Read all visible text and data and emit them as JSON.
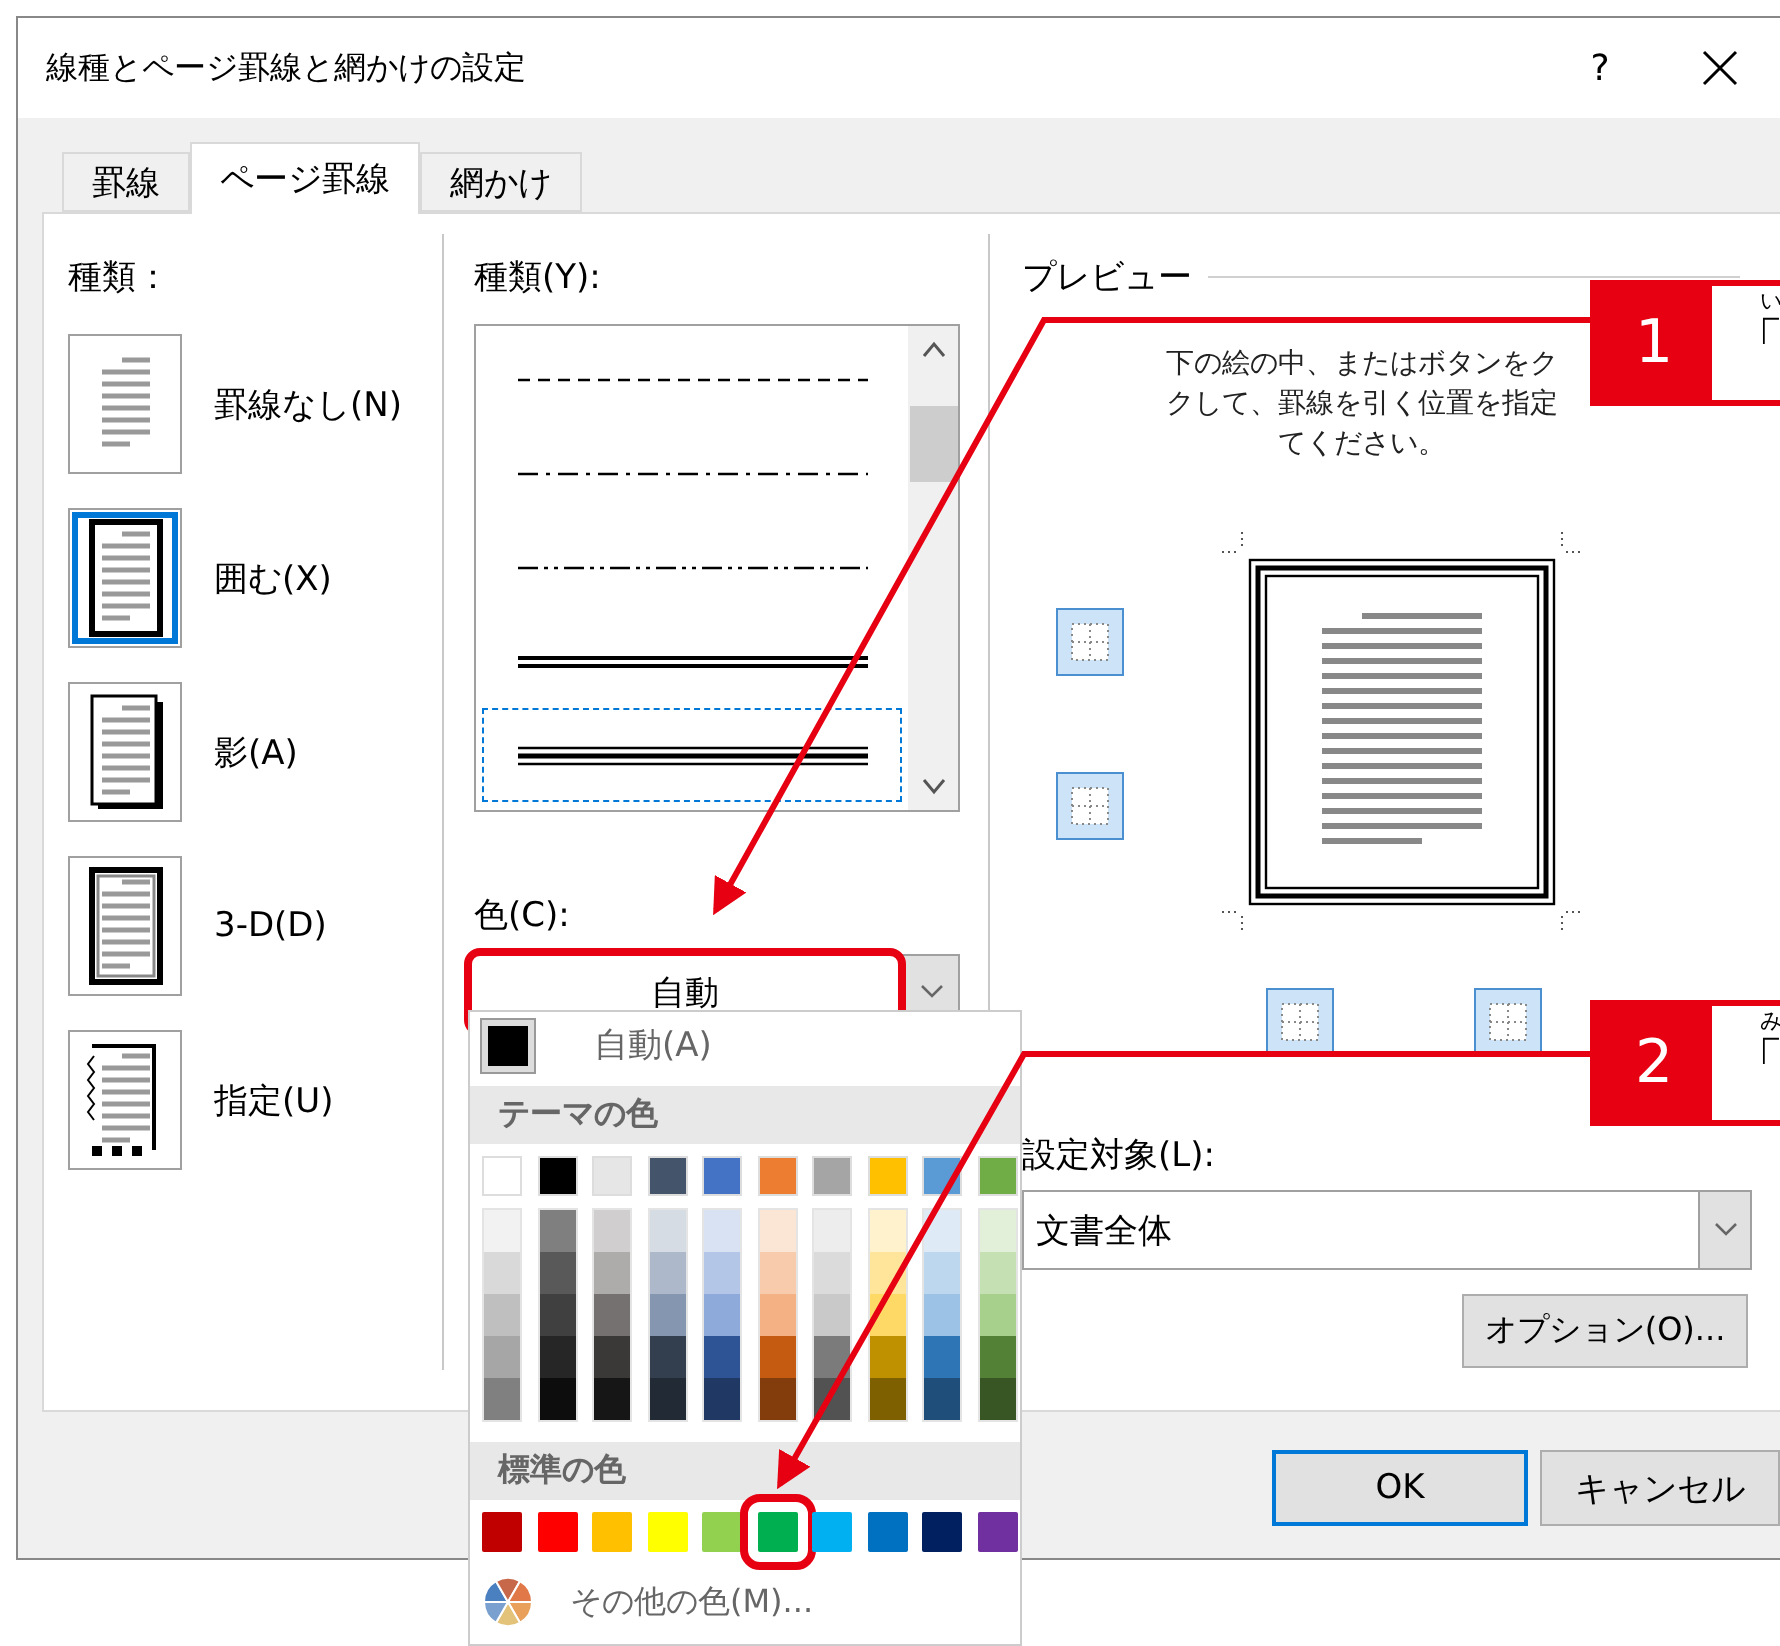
{
  "window": {
    "title": "線種とページ罫線と網かけの設定",
    "help": "?"
  },
  "tabs": [
    {
      "label": "罫線",
      "selected": false
    },
    {
      "label": "ページ罫線",
      "selected": true
    },
    {
      "label": "網かけ",
      "selected": false
    }
  ],
  "setting": {
    "label": "種類：",
    "items": [
      {
        "label": "罫線なし(N)",
        "kind": "none",
        "selected": false
      },
      {
        "label": "囲む(X)",
        "kind": "box",
        "selected": true
      },
      {
        "label": "影(A)",
        "kind": "shadow",
        "selected": false
      },
      {
        "label": "3-D(D)",
        "kind": "threed",
        "selected": false
      },
      {
        "label": "指定(U)",
        "kind": "custom",
        "selected": false
      }
    ]
  },
  "line_style": {
    "label": "種類(Y):",
    "items": [
      {
        "kind": "dashed",
        "selected": false
      },
      {
        "kind": "dashdot",
        "selected": false
      },
      {
        "kind": "dashdotdot",
        "selected": false
      },
      {
        "kind": "double",
        "selected": false
      },
      {
        "kind": "triple",
        "selected": true
      }
    ]
  },
  "color": {
    "label": "色(C):",
    "value": "自動",
    "highlighted": true
  },
  "preview": {
    "title": "プレビュー",
    "instructions": [
      "下の絵の中、またはボタンをク",
      "クして、罫線を引く位置を指定",
      "てください。"
    ]
  },
  "apply_to": {
    "label": "設定対象(L):",
    "value": "文書全体"
  },
  "options_button": "オプション(O)...",
  "buttons": [
    {
      "label": "OK",
      "selected": true
    },
    {
      "label": "キャンセル",
      "selected": false
    }
  ],
  "color_menu": {
    "automatic": "自動(A)",
    "theme_heading": "テーマの色",
    "theme_colors": [
      {
        "color": "#ffffff",
        "children": [
          {
            "color": "#f2f2f2"
          },
          {
            "color": "#d9d9d9"
          },
          {
            "color": "#bfbfbf"
          },
          {
            "color": "#a6a6a6"
          },
          {
            "color": "#808080"
          }
        ]
      },
      {
        "color": "#000000",
        "children": [
          {
            "color": "#7f7f7f"
          },
          {
            "color": "#595959"
          },
          {
            "color": "#404040"
          },
          {
            "color": "#262626"
          },
          {
            "color": "#0d0d0d"
          }
        ]
      },
      {
        "color": "#e7e6e6",
        "children": [
          {
            "color": "#d0cece"
          },
          {
            "color": "#aeabab"
          },
          {
            "color": "#767171"
          },
          {
            "color": "#3b3838"
          },
          {
            "color": "#171616"
          }
        ]
      },
      {
        "color": "#44546a",
        "children": [
          {
            "color": "#d6dce4"
          },
          {
            "color": "#adb9ca"
          },
          {
            "color": "#8496b0"
          },
          {
            "color": "#333f4f"
          },
          {
            "color": "#222a35"
          }
        ]
      },
      {
        "color": "#4472c4",
        "children": [
          {
            "color": "#d9e2f3"
          },
          {
            "color": "#b4c6e7"
          },
          {
            "color": "#8eaadb"
          },
          {
            "color": "#2f5496"
          },
          {
            "color": "#1f3864"
          }
        ]
      },
      {
        "color": "#ed7d31",
        "children": [
          {
            "color": "#fbe5d5"
          },
          {
            "color": "#f7cbac"
          },
          {
            "color": "#f4b183"
          },
          {
            "color": "#c55a11"
          },
          {
            "color": "#833c0b"
          }
        ]
      },
      {
        "color": "#a5a5a5",
        "children": [
          {
            "color": "#ededed"
          },
          {
            "color": "#dbdbdb"
          },
          {
            "color": "#c9c9c9"
          },
          {
            "color": "#7b7b7b"
          },
          {
            "color": "#525252"
          }
        ]
      },
      {
        "color": "#ffc000",
        "children": [
          {
            "color": "#fff2cc"
          },
          {
            "color": "#fee599"
          },
          {
            "color": "#ffd965"
          },
          {
            "color": "#bf9000"
          },
          {
            "color": "#7f6000"
          }
        ]
      },
      {
        "color": "#5b9bd5",
        "children": [
          {
            "color": "#deeaf6"
          },
          {
            "color": "#bdd7ee"
          },
          {
            "color": "#9cc3e5"
          },
          {
            "color": "#2e75b5"
          },
          {
            "color": "#1e4e79"
          }
        ]
      },
      {
        "color": "#70ad47",
        "children": [
          {
            "color": "#e2efd9"
          },
          {
            "color": "#c5e0b3"
          },
          {
            "color": "#a8d08d"
          },
          {
            "color": "#538135"
          },
          {
            "color": "#375623"
          }
        ]
      }
    ],
    "standard_heading": "標準の色",
    "standard_colors": [
      {
        "color": "#c00000",
        "selected": false
      },
      {
        "color": "#ff0000",
        "selected": false
      },
      {
        "color": "#ffc000",
        "selected": false
      },
      {
        "color": "#ffff00",
        "selected": false
      },
      {
        "color": "#92d050",
        "selected": false
      },
      {
        "color": "#00b050",
        "selected": true
      },
      {
        "color": "#00b0f0",
        "selected": false
      },
      {
        "color": "#0070c0",
        "selected": false
      },
      {
        "color": "#002060",
        "selected": false
      },
      {
        "color": "#7030a0",
        "selected": false
      }
    ],
    "more": "その他の色(M)..."
  },
  "callouts": [
    {
      "number": "1",
      "ruby": "い",
      "text": "「"
    },
    {
      "number": "2",
      "ruby": "み",
      "text": "「"
    }
  ]
}
